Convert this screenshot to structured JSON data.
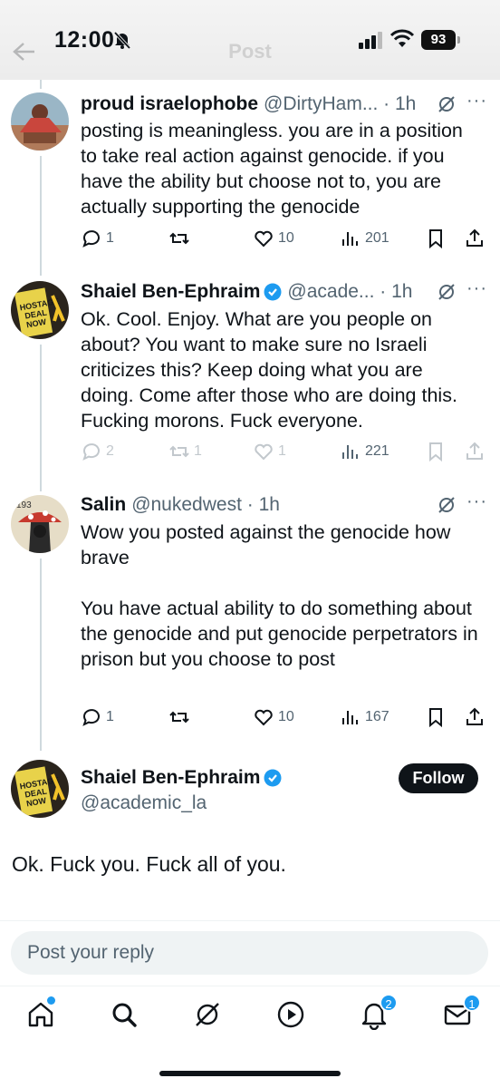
{
  "status_bar": {
    "time": "12:00",
    "battery": "93"
  },
  "header": {
    "title": "Post"
  },
  "tweets": [
    {
      "name": "proud israelophobe",
      "meta": "@DirtyHam... · 1h",
      "text": "posting is meaningless. you are in a position to take real action against genocide. if you have the ability but choose not to, you are actually supporting the genocide",
      "replies": "1",
      "reposts": "",
      "likes": "10",
      "views": "201"
    },
    {
      "name": "Shaiel Ben-Ephraim",
      "verified": true,
      "meta": "@acade... · 1h",
      "text": "Ok. Cool. Enjoy. What are you people on about? You want to make sure no Israeli criticizes this? Keep doing what you are doing. Come after those who are doing this. Fucking morons. Fuck everyone.",
      "replies": "2",
      "reposts": "1",
      "likes": "1",
      "views": "221"
    },
    {
      "name": "Salin",
      "meta": "@nukedwest · 1h",
      "text": "Wow you posted against the genocide how brave\n\nYou have actual ability to do something about the genocide and put genocide perpetrators in prison but you choose to post",
      "replies": "1",
      "reposts": "",
      "likes": "10",
      "views": "167"
    }
  ],
  "main_tweet": {
    "name": "Shaiel Ben-Ephraim",
    "verified": true,
    "handle": "@academic_la",
    "follow_label": "Follow",
    "text": "Ok. Fuck you. Fuck all of you."
  },
  "reply": {
    "placeholder": "Post your reply"
  },
  "nav": {
    "notifications_badge": "2",
    "messages_badge": "1"
  },
  "colors": {
    "accent": "#1d9bf0",
    "text": "#0f1419",
    "muted": "#536471"
  }
}
